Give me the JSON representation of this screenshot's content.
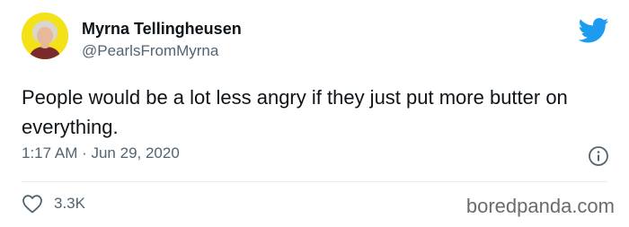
{
  "tweet": {
    "display_name": "Myrna Tellingheusen",
    "handle": "@PearlsFromMyrna",
    "text": "People would be a lot less angry if they just put more butter on everything.",
    "timestamp": "1:17 AM · Jun 29, 2020",
    "like_count": "3.3K"
  },
  "icons": {
    "brand": "twitter-bird-icon",
    "info": "info-icon",
    "like": "heart-icon"
  },
  "watermark": "boredpanda.com",
  "colors": {
    "twitter_blue": "#1d9bf0",
    "avatar_bg": "#f3e21a",
    "text_primary": "#0f1419",
    "text_secondary": "#536471"
  }
}
